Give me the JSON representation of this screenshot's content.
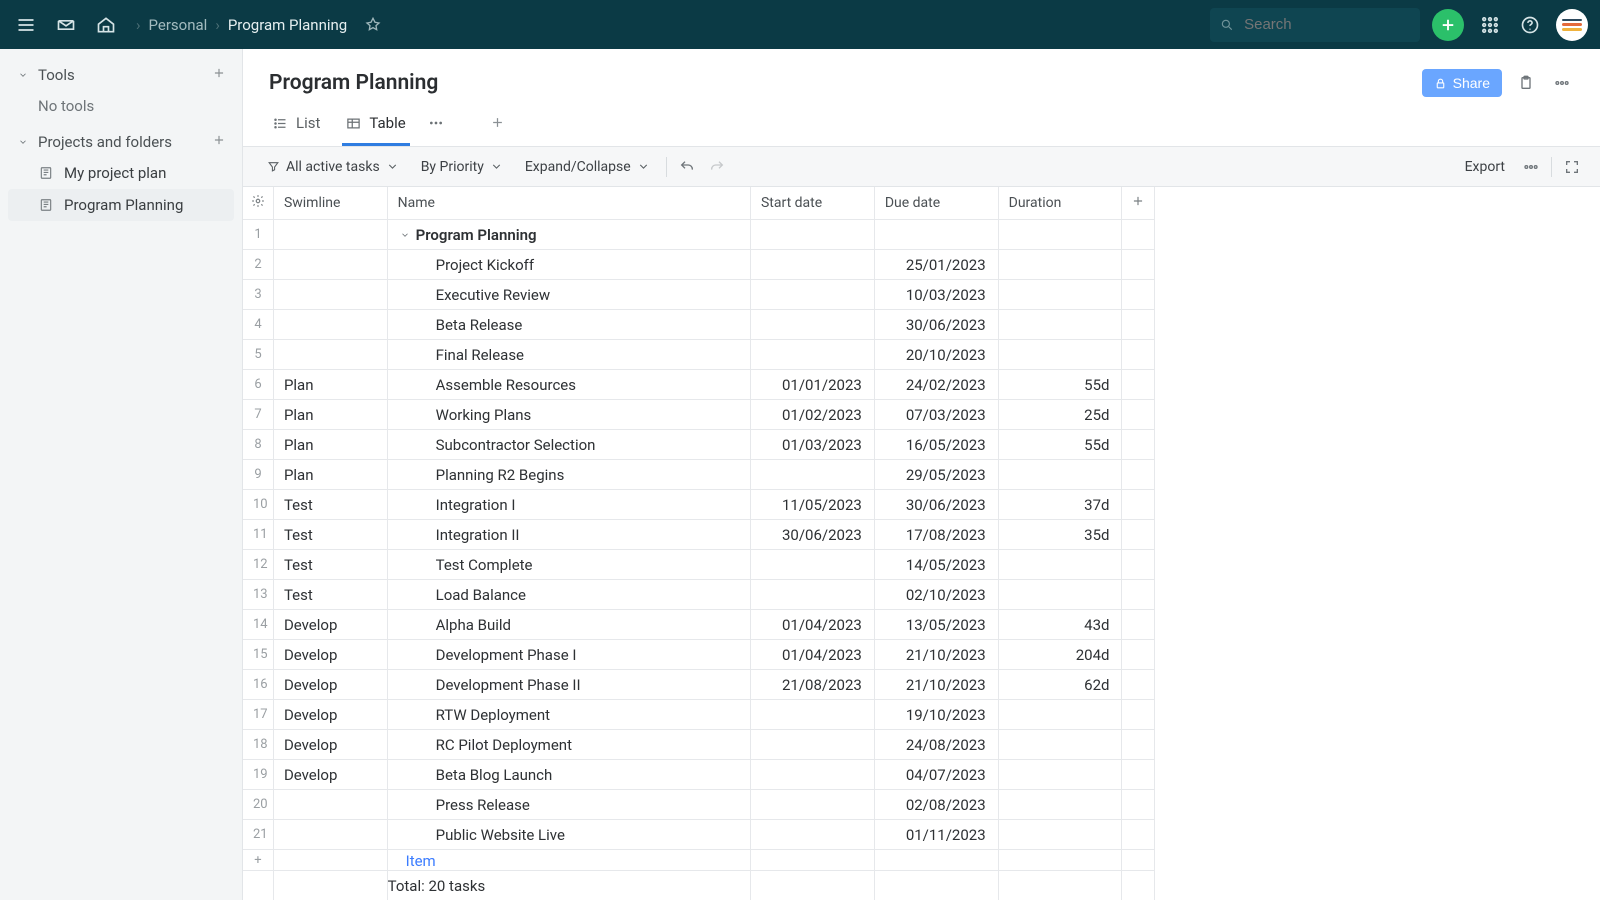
{
  "breadcrumbs": {
    "root": "Personal",
    "current": "Program Planning"
  },
  "search": {
    "placeholder": "Search"
  },
  "sidebar": {
    "sections": {
      "tools": {
        "label": "Tools",
        "empty": "No tools"
      },
      "projects": {
        "label": "Projects and folders",
        "items": [
          {
            "label": "My project plan"
          },
          {
            "label": "Program Planning"
          }
        ]
      }
    }
  },
  "page": {
    "title": "Program Planning",
    "share_label": "Share",
    "tabs": {
      "list": "List",
      "table": "Table"
    },
    "toolbar": {
      "filter": "All active tasks",
      "sort": "By Priority",
      "expand": "Expand/Collapse",
      "export": "Export"
    },
    "columns": {
      "swimline": "Swimline",
      "name": "Name",
      "start": "Start date",
      "due": "Due date",
      "duration": "Duration"
    },
    "rows": [
      {
        "num": "1",
        "swim": "",
        "name": "Program Planning",
        "indent": 0,
        "group": true,
        "start": "",
        "due": "",
        "dur": ""
      },
      {
        "num": "2",
        "swim": "",
        "name": "Project Kickoff",
        "indent": 1,
        "group": false,
        "start": "",
        "due": "25/01/2023",
        "dur": ""
      },
      {
        "num": "3",
        "swim": "",
        "name": "Executive Review",
        "indent": 1,
        "group": false,
        "start": "",
        "due": "10/03/2023",
        "dur": ""
      },
      {
        "num": "4",
        "swim": "",
        "name": "Beta Release",
        "indent": 1,
        "group": false,
        "start": "",
        "due": "30/06/2023",
        "dur": ""
      },
      {
        "num": "5",
        "swim": "",
        "name": "Final Release",
        "indent": 1,
        "group": false,
        "start": "",
        "due": "20/10/2023",
        "dur": ""
      },
      {
        "num": "6",
        "swim": "Plan",
        "name": "Assemble Resources",
        "indent": 1,
        "group": false,
        "start": "01/01/2023",
        "due": "24/02/2023",
        "dur": "55d"
      },
      {
        "num": "7",
        "swim": "Plan",
        "name": "Working Plans",
        "indent": 1,
        "group": false,
        "start": "01/02/2023",
        "due": "07/03/2023",
        "dur": "25d"
      },
      {
        "num": "8",
        "swim": "Plan",
        "name": "Subcontractor Selection",
        "indent": 1,
        "group": false,
        "start": "01/03/2023",
        "due": "16/05/2023",
        "dur": "55d"
      },
      {
        "num": "9",
        "swim": "Plan",
        "name": "Planning R2 Begins",
        "indent": 1,
        "group": false,
        "start": "",
        "due": "29/05/2023",
        "dur": ""
      },
      {
        "num": "10",
        "swim": "Test",
        "name": "Integration I",
        "indent": 1,
        "group": false,
        "start": "11/05/2023",
        "due": "30/06/2023",
        "dur": "37d"
      },
      {
        "num": "11",
        "swim": "Test",
        "name": "Integration II",
        "indent": 1,
        "group": false,
        "start": "30/06/2023",
        "due": "17/08/2023",
        "dur": "35d"
      },
      {
        "num": "12",
        "swim": "Test",
        "name": "Test Complete",
        "indent": 1,
        "group": false,
        "start": "",
        "due": "14/05/2023",
        "dur": ""
      },
      {
        "num": "13",
        "swim": "Test",
        "name": "Load Balance",
        "indent": 1,
        "group": false,
        "start": "",
        "due": "02/10/2023",
        "dur": ""
      },
      {
        "num": "14",
        "swim": "Develop",
        "name": "Alpha Build",
        "indent": 1,
        "group": false,
        "start": "01/04/2023",
        "due": "13/05/2023",
        "dur": "43d"
      },
      {
        "num": "15",
        "swim": "Develop",
        "name": "Development Phase I",
        "indent": 1,
        "group": false,
        "start": "01/04/2023",
        "due": "21/10/2023",
        "dur": "204d"
      },
      {
        "num": "16",
        "swim": "Develop",
        "name": "Development Phase II",
        "indent": 1,
        "group": false,
        "start": "21/08/2023",
        "due": "21/10/2023",
        "dur": "62d"
      },
      {
        "num": "17",
        "swim": "Develop",
        "name": "RTW Deployment",
        "indent": 1,
        "group": false,
        "start": "",
        "due": "19/10/2023",
        "dur": ""
      },
      {
        "num": "18",
        "swim": "Develop",
        "name": "RC Pilot Deployment",
        "indent": 1,
        "group": false,
        "start": "",
        "due": "24/08/2023",
        "dur": ""
      },
      {
        "num": "19",
        "swim": "Develop",
        "name": "Beta Blog Launch",
        "indent": 1,
        "group": false,
        "start": "",
        "due": "04/07/2023",
        "dur": ""
      },
      {
        "num": "20",
        "swim": "",
        "name": "Press Release",
        "indent": 1,
        "group": false,
        "start": "",
        "due": "02/08/2023",
        "dur": ""
      },
      {
        "num": "21",
        "swim": "",
        "name": "Public Website Live",
        "indent": 1,
        "group": false,
        "start": "",
        "due": "01/11/2023",
        "dur": ""
      }
    ],
    "new_item_label": "Item",
    "footer_total": "Total: 20 tasks"
  }
}
